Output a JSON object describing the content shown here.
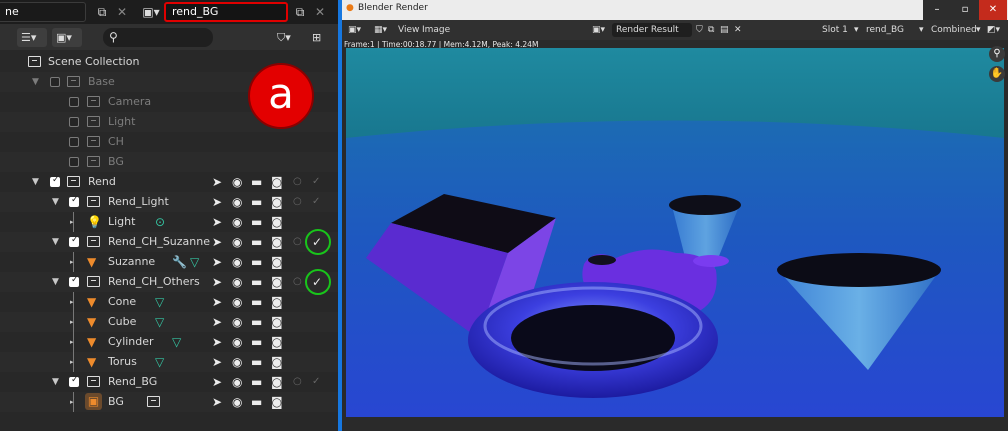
{
  "topbar": {
    "scene_name_fragment": "ne",
    "view_layer_name": "rend_BG"
  },
  "outliner": {
    "search_placeholder": "",
    "search_icon": "⚲",
    "rows": [
      {
        "label": "Scene Collection"
      },
      {
        "label": "Base"
      },
      {
        "label": "Camera"
      },
      {
        "label": "Light"
      },
      {
        "label": "CH"
      },
      {
        "label": "BG"
      },
      {
        "label": "Rend"
      },
      {
        "label": "Rend_Light"
      },
      {
        "label": "Light"
      },
      {
        "label": "Rend_CH_Suzanne"
      },
      {
        "label": "Suzanne"
      },
      {
        "label": "Rend_CH_Others"
      },
      {
        "label": "Cone"
      },
      {
        "label": "Cube"
      },
      {
        "label": "Cylinder"
      },
      {
        "label": "Torus"
      },
      {
        "label": "Rend_BG"
      },
      {
        "label": "BG"
      }
    ]
  },
  "annotation": {
    "letter": "a"
  },
  "render_window": {
    "title": "Blender Render",
    "menu_view": "View",
    "menu_image": "Image",
    "image_name": "Render Result",
    "slot": "Slot 1",
    "layer": "rend_BG",
    "pass": "Combined",
    "metadata": "Frame:1 | Time:00:18.77 | Mem:4.12M, Peak: 4.24M"
  },
  "colors": {
    "selection_highlight": "#e00000",
    "annotation_red": "#e30000",
    "holdout_ring": "#19c51b",
    "panel_divider": "#1677e0",
    "object_orange": "#ee8b2c",
    "mesh_data_green": "#35c6a3"
  }
}
